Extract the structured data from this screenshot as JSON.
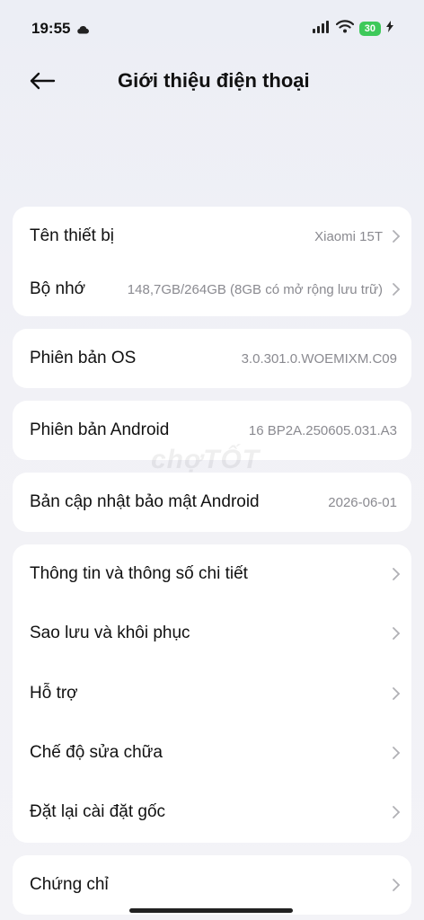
{
  "status": {
    "time": "19:55",
    "battery": "30"
  },
  "header": {
    "title": "Giới thiệu điện thoại"
  },
  "device": {
    "name_label": "Tên thiết bị",
    "name_value": "Xiaomi 15T",
    "storage_label": "Bộ nhớ",
    "storage_value": "148,7GB/264GB (8GB có mở rộng lưu trữ)"
  },
  "os": {
    "label": "Phiên bản OS",
    "value": "3.0.301.0.WOEMIXM.C09"
  },
  "android": {
    "label": "Phiên bản Android",
    "value": "16 BP2A.250605.031.A3"
  },
  "security": {
    "label": "Bản cập nhật bảo mật Android",
    "value": "2026-06-01"
  },
  "menu": {
    "items": [
      "Thông tin và thông số chi tiết",
      "Sao lưu và khôi phục",
      "Hỗ trợ",
      "Chế độ sửa chữa",
      "Đặt lại cài đặt gốc"
    ]
  },
  "certs": {
    "label": "Chứng chỉ"
  },
  "watermark": "chợTỐT"
}
